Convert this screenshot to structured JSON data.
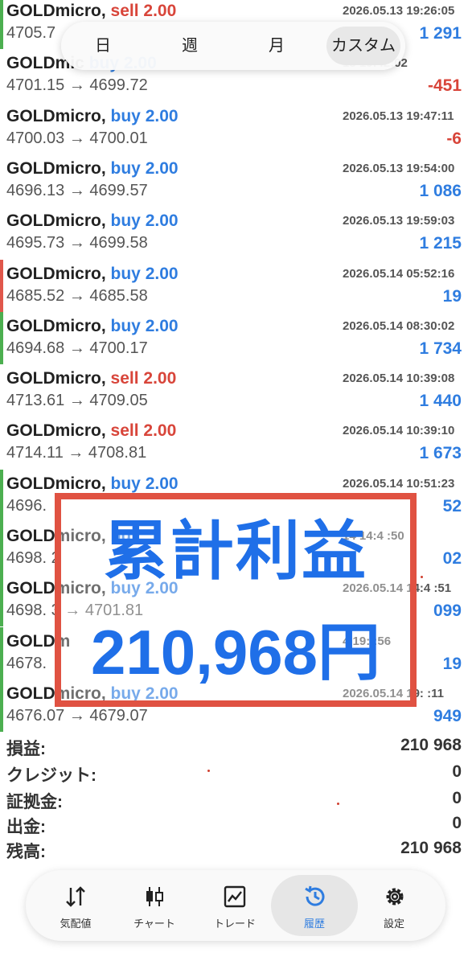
{
  "tabs": [
    "日",
    "週",
    "月",
    "カスタム"
  ],
  "active_tab": 3,
  "trades": [
    {
      "symbol": "GOLDmicro,",
      "side": "sell",
      "volume": "2.00",
      "time": "2026.05.13 19:26:05",
      "prices": "4705.7",
      "profit": "1 291",
      "bar": "green"
    },
    {
      "symbol": "GOLDmic",
      "side": "buy",
      "volume": "2.00",
      "time": "13 19:42:02",
      "prices": "4701.15 → 4699.72",
      "profit": "-451",
      "bar": "none"
    },
    {
      "symbol": "GOLDmicro,",
      "side": "buy",
      "volume": "2.00",
      "time": "2026.05.13 19:47:11",
      "prices": "4700.03 → 4700.01",
      "profit": "-6",
      "bar": "none"
    },
    {
      "symbol": "GOLDmicro,",
      "side": "buy",
      "volume": "2.00",
      "time": "2026.05.13 19:54:00",
      "prices": "4696.13 → 4699.57",
      "profit": "1 086",
      "bar": "none"
    },
    {
      "symbol": "GOLDmicro,",
      "side": "buy",
      "volume": "2.00",
      "time": "2026.05.13 19:59:03",
      "prices": "4695.73 → 4699.58",
      "profit": "1 215",
      "bar": "none"
    },
    {
      "symbol": "GOLDmicro,",
      "side": "buy",
      "volume": "2.00",
      "time": "2026.05.14 05:52:16",
      "prices": "4685.52 → 4685.58",
      "profit": "19",
      "bar": "red"
    },
    {
      "symbol": "GOLDmicro,",
      "side": "buy",
      "volume": "2.00",
      "time": "2026.05.14 08:30:02",
      "prices": "4694.68 → 4700.17",
      "profit": "1 734",
      "bar": "green"
    },
    {
      "symbol": "GOLDmicro,",
      "side": "sell",
      "volume": "2.00",
      "time": "2026.05.14 10:39:08",
      "prices": "4713.61 → 4709.05",
      "profit": "1 440",
      "bar": "none"
    },
    {
      "symbol": "GOLDmicro,",
      "side": "sell",
      "volume": "2.00",
      "time": "2026.05.14 10:39:10",
      "prices": "4714.11 → 4708.81",
      "profit": "1 673",
      "bar": "none"
    },
    {
      "symbol": "GOLDmicro,",
      "side": "buy",
      "volume": "2.00",
      "time": "2026.05.14 10:51:23",
      "prices": "4696.",
      "profit": "52",
      "bar": "green"
    },
    {
      "symbol": "GOLDmicro,",
      "side": "buy",
      "volume": "",
      "time": "14 14:4 :50",
      "prices": "4698. 2",
      "profit": "02",
      "bar": "green"
    },
    {
      "symbol": "GOLDmicro,",
      "side": "buy",
      "volume": "2.00",
      "time": "2026.05.14 14:4 :51",
      "prices": "4698. 3 → 4701.81",
      "profit": "099",
      "bar": "green"
    },
    {
      "symbol": "GOLDm",
      "side": "",
      "volume": "",
      "time": "4 19: :56",
      "prices": "4678.",
      "profit": "19",
      "bar": "green"
    },
    {
      "symbol": "GOLDmicro,",
      "side": "buy",
      "volume": "2.00",
      "time": "2026.05.14 19: :11",
      "prices": "4676.07 → 4679.07",
      "profit": "949",
      "bar": "green"
    }
  ],
  "summary": [
    {
      "label": "損益:",
      "value": "210 968"
    },
    {
      "label": "クレジット:",
      "value": "0"
    },
    {
      "label": "証拠金:",
      "value": "0"
    },
    {
      "label": "出金:",
      "value": "0"
    },
    {
      "label": "残高:",
      "value": "210 968"
    }
  ],
  "overlay": {
    "line1": "累計利益",
    "line2": "210,968円"
  },
  "nav": [
    {
      "label": "気配値",
      "icon": "quotes-icon"
    },
    {
      "label": "チャート",
      "icon": "chart-icon"
    },
    {
      "label": "トレード",
      "icon": "trade-icon"
    },
    {
      "label": "履歴",
      "icon": "history-icon"
    },
    {
      "label": "設定",
      "icon": "settings-icon"
    }
  ],
  "active_nav": 3,
  "colors": {
    "buy": "#2f7de0",
    "sell": "#d8453a",
    "accent": "#1f6fe8",
    "frame": "#e05242"
  }
}
